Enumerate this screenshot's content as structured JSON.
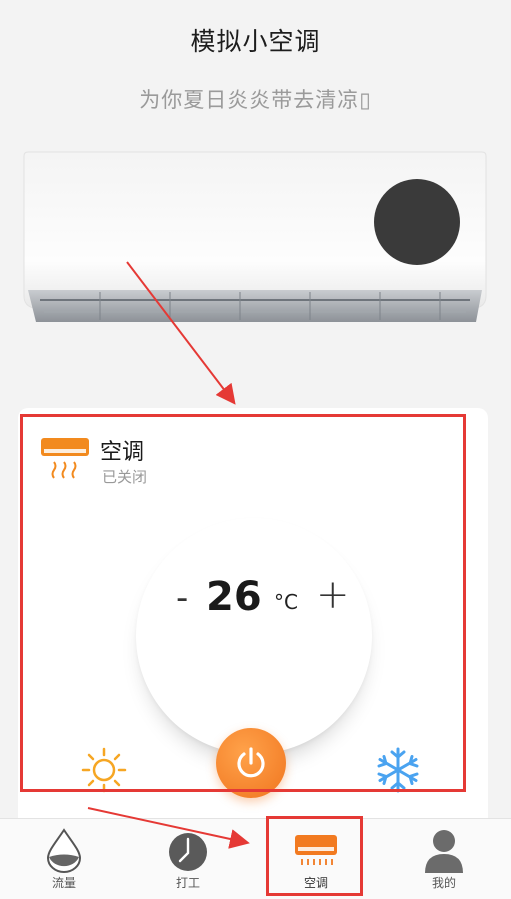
{
  "header": {
    "title": "模拟小空调",
    "subtitle": "为你夏日炎炎带去清凉▯"
  },
  "ac_card": {
    "name": "空调",
    "status": "已关闭",
    "temperature": "26",
    "unit": "°C",
    "minus_label": "-",
    "plus_label": "+"
  },
  "bottom_nav": {
    "items": [
      {
        "label": "流量",
        "icon": "water-drop-icon"
      },
      {
        "label": "打工",
        "icon": "clock-icon"
      },
      {
        "label": "空调",
        "icon": "air-conditioner-icon",
        "active": true
      },
      {
        "label": "我的",
        "icon": "user-icon"
      }
    ]
  },
  "colors": {
    "accent": "#f27a20",
    "annotation_red": "#e53935",
    "cool_blue": "#4aa3f0",
    "heat_orange": "#f6a623"
  }
}
